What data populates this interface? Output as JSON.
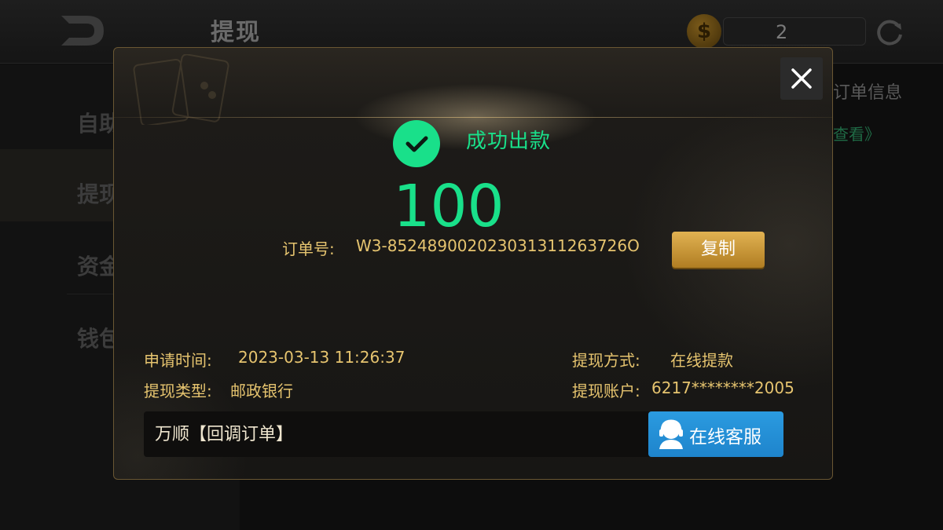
{
  "page": {
    "title": "提现",
    "balance": "2"
  },
  "sidebar": {
    "items": [
      {
        "label": "自助"
      },
      {
        "label": "提现"
      },
      {
        "label": "资金"
      },
      {
        "label": "钱包"
      }
    ]
  },
  "background": {
    "right_info": "订单信息",
    "right_link": "查看》"
  },
  "modal": {
    "status": "成功出款",
    "amount": "100",
    "order_label": "订单号:",
    "order_number": "W3-852489002023031311263726O",
    "copy_label": "复制",
    "apply_time_label": "申请时间:",
    "apply_time": "2023-03-13 11:26:37",
    "method_label": "提现方式:",
    "method": "在线提款",
    "type_label": "提现类型:",
    "type": "邮政银行",
    "account_label": "提现账户:",
    "account": "6217********2005",
    "merchant_text": "万顺【回调订单】",
    "service_label": "在线客服"
  },
  "colors": {
    "success": "#19e08a",
    "gold_text": "#e6c46f",
    "service_blue": "#1e84cc"
  }
}
